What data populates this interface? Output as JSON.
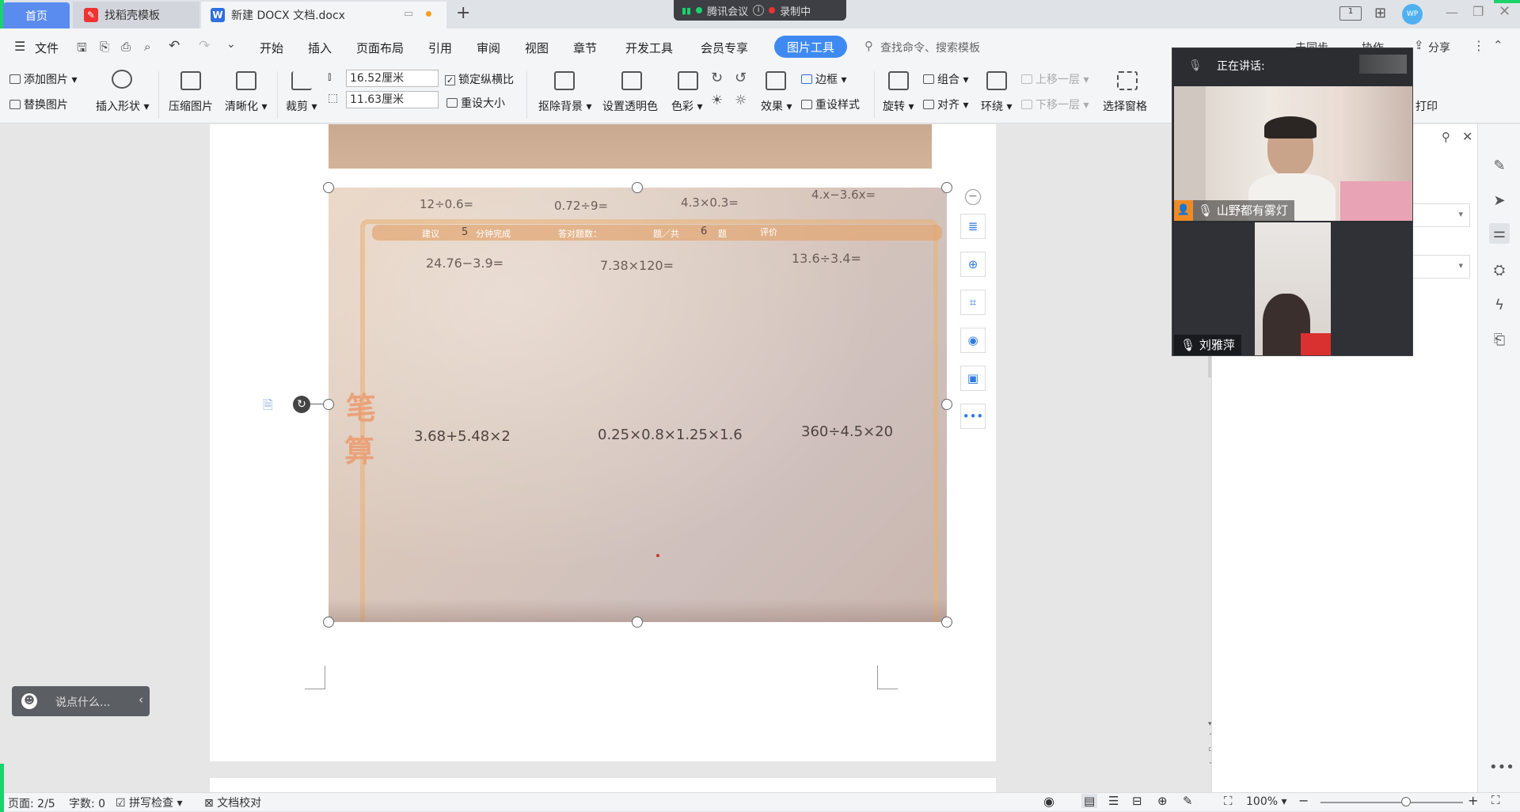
{
  "tabs": {
    "home": "首页",
    "daoke": "找稻壳模板",
    "doc": "新建 DOCX 文档.docx"
  },
  "meeting": {
    "app": "腾讯会议",
    "recording": "录制中",
    "speaking_label": "正在讲话:",
    "participant1": "山野都有雾灯",
    "participant2": "刘雅萍"
  },
  "menu": {
    "file": "文件",
    "items": [
      "开始",
      "插入",
      "页面布局",
      "引用",
      "审阅",
      "视图",
      "章节",
      "开发工具",
      "会员专享"
    ],
    "picture_tools": "图片工具",
    "search_placeholder": "查找命令、搜索模板",
    "unsync": "未同步",
    "collab": "协作",
    "share": "分享"
  },
  "ribbon": {
    "add_picture": "添加图片",
    "replace_picture": "替换图片",
    "insert_shape": "插入形状",
    "compress": "压缩图片",
    "clarity": "清晰化",
    "crop": "裁剪",
    "width": "16.52厘米",
    "height": "11.63厘米",
    "lock_ratio": "锁定纵横比",
    "reset_size": "重设大小",
    "remove_bg": "抠除背景",
    "set_transparent": "设置透明色",
    "color": "色彩",
    "effects": "效果",
    "border": "边框",
    "reset_style": "重设样式",
    "rotate": "旋转",
    "group": "组合",
    "align": "对齐",
    "wrap": "环绕",
    "bring_forward": "上移一层",
    "send_backward": "下移一层",
    "selection_pane": "选择窗格",
    "print": "打印"
  },
  "photo": {
    "row1": [
      "12÷0.6=",
      "0.72÷9=",
      "4.3×0.3=",
      "4.x−3.6x="
    ],
    "banner": [
      "建议",
      "5",
      "分钟完成",
      "答对题数：",
      "题／共",
      "6",
      "题",
      "评价"
    ],
    "row2": [
      "24.76−3.9=",
      "7.38×120=",
      "13.6÷3.4="
    ],
    "side_chars": [
      "笔",
      "算"
    ],
    "row3": [
      "3.68+5.48×2",
      "0.25×0.8×1.25×1.6",
      "360÷4.5×20"
    ]
  },
  "comment_placeholder": "说点什么...",
  "status": {
    "page": "页面: 2/5",
    "words": "字数: 0",
    "spell": "拼写检查",
    "proof": "文档校对",
    "zoom": "100%",
    "zoom_level": 0.6
  }
}
